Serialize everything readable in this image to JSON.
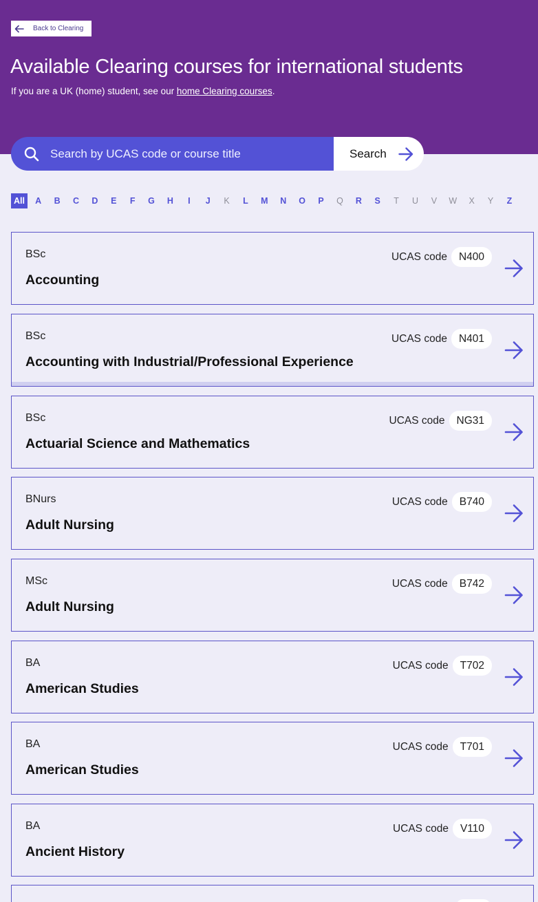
{
  "header": {
    "back_label": "Back to Clearing",
    "title": "Available Clearing courses for international students",
    "intro_prefix": "If you are a UK (home) student, see our ",
    "intro_link": "home Clearing courses",
    "intro_suffix": "."
  },
  "search": {
    "placeholder": "Search by UCAS code or course title",
    "button_label": "Search"
  },
  "alphabet": {
    "active": "All",
    "letters": [
      "A",
      "B",
      "C",
      "D",
      "E",
      "F",
      "G",
      "H",
      "I",
      "J",
      "K",
      "L",
      "M",
      "N",
      "O",
      "P",
      "Q",
      "R",
      "S",
      "T",
      "U",
      "V",
      "W",
      "X",
      "Y",
      "Z"
    ],
    "disabled": [
      "K",
      "Q",
      "T",
      "U",
      "V",
      "W",
      "X",
      "Y"
    ]
  },
  "courses": [
    {
      "award": "BSc",
      "title": "Accounting",
      "ucas_label": "UCAS code",
      "code": "N400"
    },
    {
      "award": "BSc",
      "title": "Accounting with Industrial/Professional Experience",
      "ucas_label": "UCAS code",
      "code": "N401"
    },
    {
      "award": "BSc",
      "title": "Actuarial Science and Mathematics",
      "ucas_label": "UCAS code",
      "code": "NG31"
    },
    {
      "award": "BNurs",
      "title": "Adult Nursing",
      "ucas_label": "UCAS code",
      "code": "B740"
    },
    {
      "award": "MSc",
      "title": "Adult Nursing",
      "ucas_label": "UCAS code",
      "code": "B742"
    },
    {
      "award": "BA",
      "title": "American Studies",
      "ucas_label": "UCAS code",
      "code": "T702"
    },
    {
      "award": "BA",
      "title": "American Studies",
      "ucas_label": "UCAS code",
      "code": "T701"
    },
    {
      "award": "BA",
      "title": "Ancient History",
      "ucas_label": "UCAS code",
      "code": "V110"
    }
  ],
  "colors": {
    "header_bg": "#6a2c91",
    "accent": "#5352d6",
    "page_bg": "#eeedf8"
  }
}
